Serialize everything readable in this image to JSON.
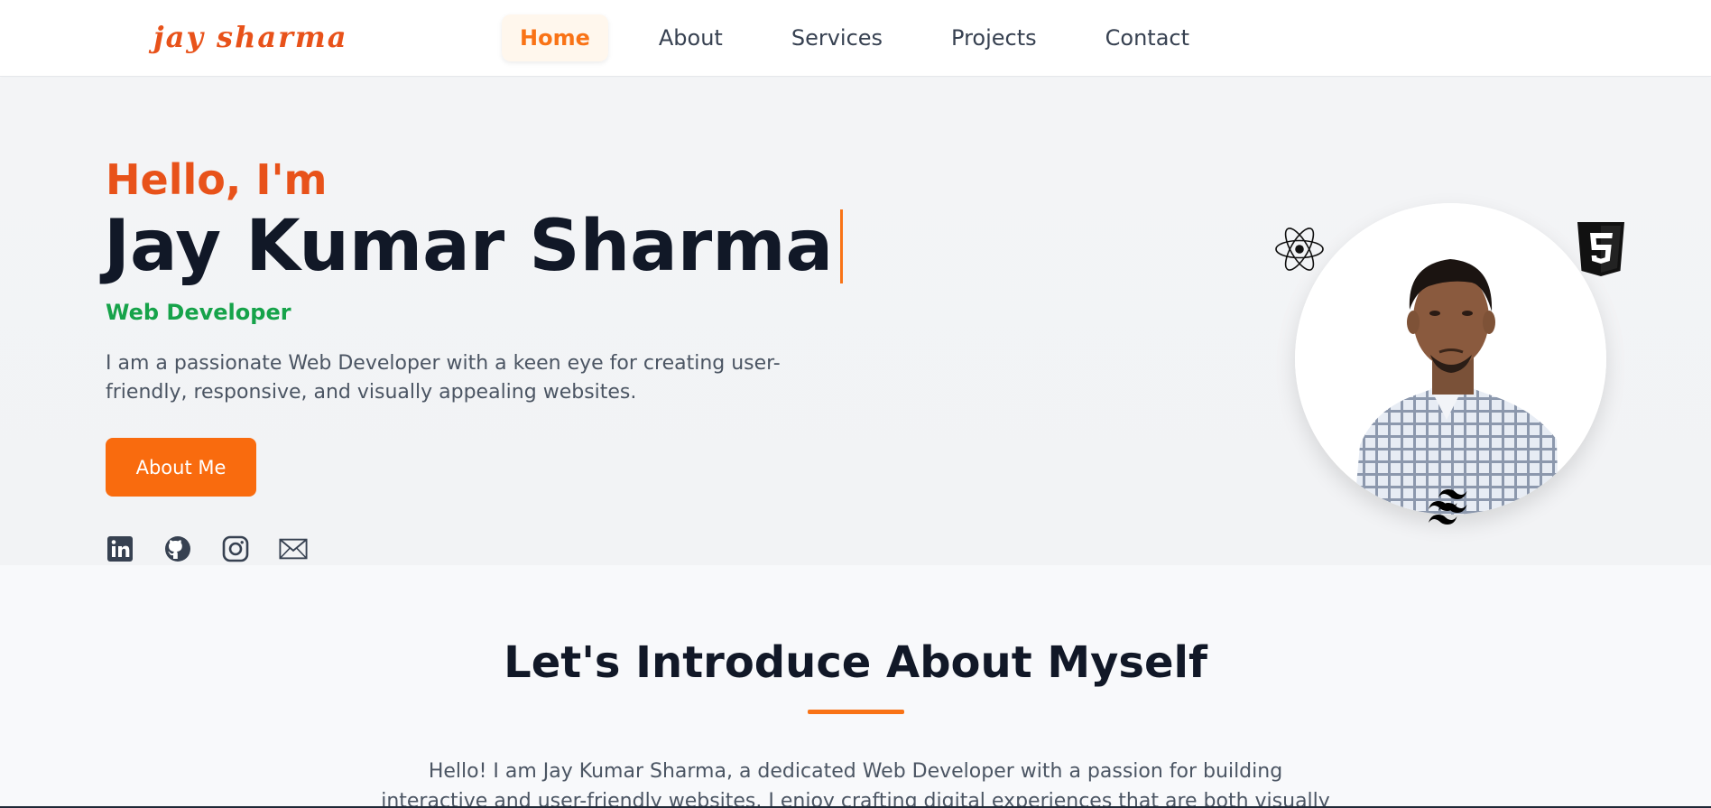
{
  "header": {
    "logo": "jay sharma",
    "nav": [
      "Home",
      "About",
      "Services",
      "Projects",
      "Contact"
    ],
    "active_index": 0
  },
  "hero": {
    "greeting": "Hello, I'm",
    "name": "Jay Kumar Sharma",
    "role": "Web Developer",
    "bio": "I am a passionate Web Developer with a keen eye for creating user-friendly, responsive, and visually appealing websites.",
    "cta_label": "About Me",
    "socials": [
      "linkedin-icon",
      "github-icon",
      "instagram-icon",
      "mail-icon"
    ],
    "tech_icons": [
      "react-icon",
      "html5-icon",
      "tailwind-icon"
    ]
  },
  "about": {
    "title": "Let's Introduce About Myself",
    "text": "Hello! I am Jay Kumar Sharma, a dedicated Web Developer with a passion for building interactive and user-friendly websites. I enjoy crafting digital experiences that are both visually"
  },
  "colors": {
    "accent": "#f97316",
    "greeting": "#e8521a",
    "role": "#16a34a",
    "heading": "#111827",
    "body_text": "#4b5563"
  }
}
